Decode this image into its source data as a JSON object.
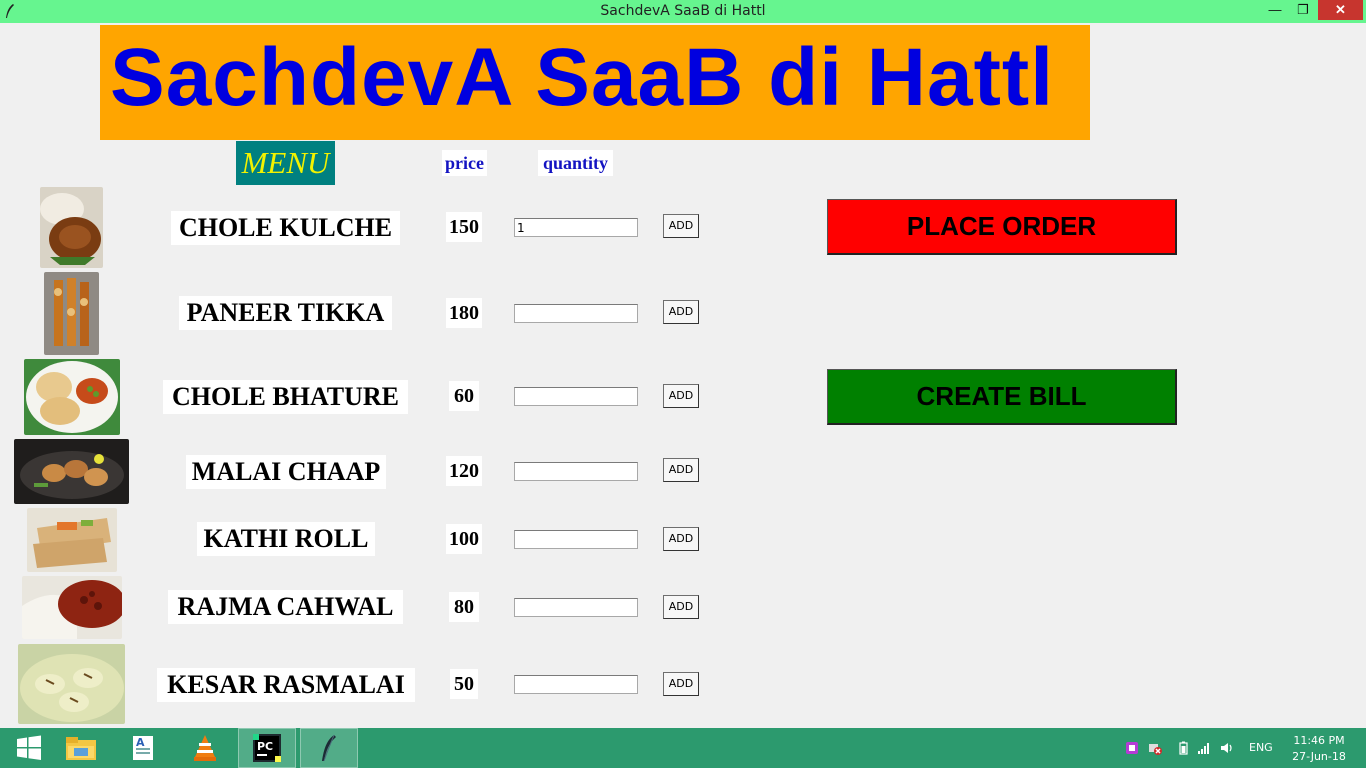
{
  "window": {
    "title": "SachdevA SaaB di Hattl",
    "minimize_glyph": "—",
    "maximize_glyph": "❐",
    "close_glyph": "✕"
  },
  "banner": {
    "heading": "SachdevA SaaB di Hattl"
  },
  "columns": {
    "menu": "MENU",
    "price": "price",
    "quantity": "quantity"
  },
  "items": [
    {
      "name": "CHOLE KULCHE",
      "price": "150",
      "quantity": "1",
      "add_label": "ADD",
      "image": "chole-kulche-image"
    },
    {
      "name": "PANEER TIKKA",
      "price": "180",
      "quantity": "",
      "add_label": "ADD",
      "image": "paneer-tikka-image"
    },
    {
      "name": "CHOLE BHATURE",
      "price": "60",
      "quantity": "",
      "add_label": "ADD",
      "image": "chole-bhature-image"
    },
    {
      "name": "MALAI CHAAP",
      "price": "120",
      "quantity": "",
      "add_label": "ADD",
      "image": "malai-chaap-image"
    },
    {
      "name": "KATHI ROLL",
      "price": "100",
      "quantity": "",
      "add_label": "ADD",
      "image": "kathi-roll-image"
    },
    {
      "name": "RAJMA CAHWAL",
      "price": "80",
      "quantity": "",
      "add_label": "ADD",
      "image": "rajma-chawal-image"
    },
    {
      "name": "KESAR RASMALAI",
      "price": "50",
      "quantity": "",
      "add_label": "ADD",
      "image": "kesar-rasmalai-image"
    }
  ],
  "actions": {
    "place_order": "PLACE ORDER",
    "create_bill": "CREATE BILL"
  },
  "taskbar": {
    "apps": [
      "windows-start-icon",
      "file-explorer-icon",
      "wordpad-icon",
      "vlc-icon",
      "pycharm-icon",
      "python-feather-icon"
    ],
    "language": "ENG",
    "time": "11:46 PM",
    "date": "27-Jun-18"
  },
  "colors": {
    "titlebar": "#66f58f",
    "banner_bg": "#ffa500",
    "banner_text": "#0000e0",
    "menu_bg": "#008080",
    "menu_text": "#f2f200",
    "place_order_bg": "#ff0000",
    "create_bill_bg": "#008000",
    "taskbar": "#2c9a6e"
  }
}
